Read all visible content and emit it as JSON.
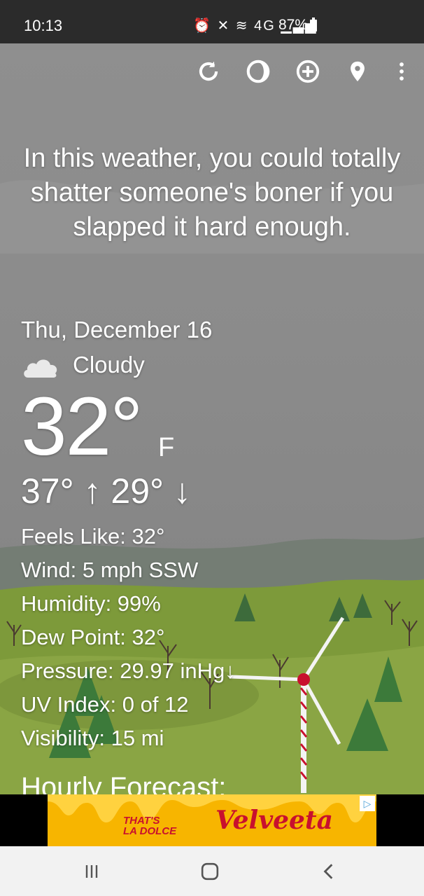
{
  "status": {
    "time": "10:13",
    "battery": "87%",
    "network": "4G"
  },
  "toolbar": {
    "icons": [
      "refresh-icon",
      "theme-icon",
      "add-location-icon",
      "location-pin-icon",
      "overflow-menu-icon"
    ]
  },
  "quote": "In this weather, you could totally shatter someone's boner if you slapped it hard enough.",
  "weather": {
    "date": "Thu, December 16",
    "condition": "Cloudy",
    "temperature": "32°",
    "unit": "F",
    "hilo": "37° ↑  29° ↓",
    "details": [
      "Feels Like:  32°",
      "Wind:  5 mph SSW",
      "Humidity:  99%",
      "Dew Point:  32°",
      "Pressure:  29.97 inHg↓",
      "UV Index:  0 of 12",
      "Visibility:  15 mi"
    ],
    "hourly_heading": "Hourly Forecast:"
  },
  "ad": {
    "line1": "THAT'S",
    "line2": "LA DOLCE",
    "brand": "Velveeta"
  },
  "colors": {
    "sky": "#8a8a8a",
    "hills": "#7d9a3a",
    "ad_bg": "#f7b500",
    "ad_text": "#c8102e"
  }
}
